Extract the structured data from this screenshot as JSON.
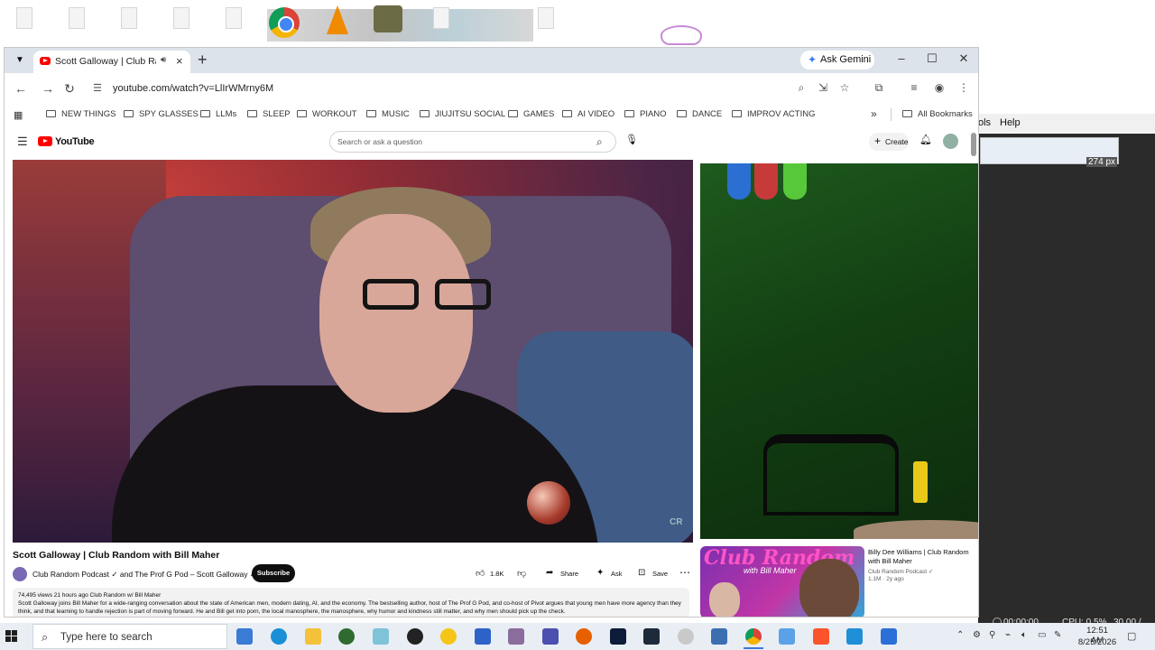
{
  "browser": {
    "tab_title": "Scott Galloway | Club Rand",
    "ask_gemini": "Ask Gemini",
    "url": "youtube.com/watch?v=LlIrWMrny6M",
    "bookmarks": [
      "NEW THINGS",
      "SPY GLASSES",
      "LLMs",
      "SLEEP",
      "WORKOUT",
      "MUSIC",
      "JIUJITSU SOCIAL",
      "GAMES",
      "AI VIDEO",
      "PIANO",
      "DANCE",
      "IMPROV ACTING"
    ],
    "all_bookmarks": "All Bookmarks"
  },
  "youtube": {
    "logo_text": "YouTube",
    "search_placeholder": "Search or ask a question",
    "create_label": "Create",
    "video_title": "Scott Galloway | Club Random with Bill Maher",
    "channel": "Club Random Podcast ✓ and The Prof G Pod – Scott Galloway ✓",
    "subscribe": "Subscribe",
    "like_count": "1.8K",
    "share": "Share",
    "ask": "Ask",
    "save": "Save",
    "description_meta": "74,495 views  21 hours ago  Club Random w/ Bill Maher",
    "description_text": "Scott Galloway joins Bill Maher for a wide-ranging conversation about the state of American men, modern dating, AI, and the economy. The bestselling author, host of The Prof G Pod, and co-host of Pivot argues that young men have more agency than they think, and that learning to handle rejection is part of moving forward. He and Bill get into porn, the local manosphere, the manosphere, why humor and kindness still matter, and why men should pick up the check.",
    "video_watermark": "CR",
    "recommendation": {
      "thumb_title": "Club Random",
      "thumb_subtitle": "with Bill Maher",
      "title": "Billy Dee Williams | Club Random with Bill Maher",
      "channel": "Club Random Podcast ✓",
      "meta": "1.1M · 2y ago"
    }
  },
  "bg_app": {
    "menu_tools": "ols",
    "menu_help": "Help",
    "ruler_value": "274 px",
    "time": "00:00:00",
    "cpu": "CPU: 0.5%",
    "fps": "30.00 / 30.00"
  },
  "taskbar": {
    "search_placeholder": "Type here to search",
    "time": "12:51 AM",
    "date": "8/25/2026"
  },
  "colors": {
    "youtube_red": "#ff0000",
    "chrome_tabstrip": "#dde3ea",
    "taskbar": "#e9eef5",
    "green_screen": "#1e5a1e"
  }
}
